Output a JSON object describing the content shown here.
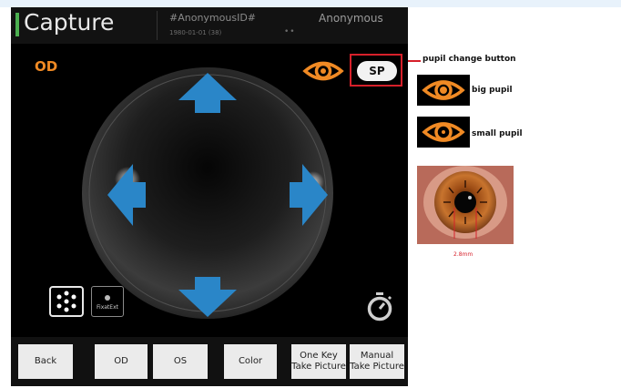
{
  "header": {
    "title": "Capture",
    "patient_id": "#AnonymousID#",
    "patient_dob": "1980-01-01 (38)",
    "patient_extra": "••",
    "patient_name": "Anonymous"
  },
  "viewer": {
    "eye_label": "OD",
    "sp_button_label": "SP",
    "fixation_label": "FixatExt"
  },
  "bottom_buttons": {
    "back": "Back",
    "od": "OD",
    "os": "OS",
    "color": "Color",
    "one_key": "One Key\nTake Picture",
    "manual": "Manual\nTake Picture"
  },
  "annotations": {
    "pupil_change": "pupil change button",
    "big_pupil": "big pupil",
    "small_pupil": "small pupil",
    "measurement": "2.8mm"
  },
  "colors": {
    "accent_orange": "#f08a24",
    "arrow_blue": "#2a86c8",
    "highlight_red": "#d6202a",
    "title_bar_accent": "#4caf50"
  }
}
